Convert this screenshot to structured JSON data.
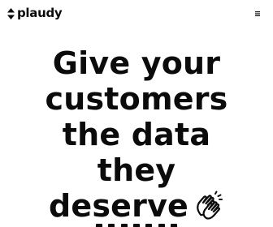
{
  "header": {
    "brand_name": "plaudy",
    "brand_icon": "up-down-arrows-icon",
    "menu_icon": "hamburger-menu-icon"
  },
  "hero": {
    "title_lines": [
      "Give your",
      "customers",
      "the data",
      "they",
      "deserve"
    ],
    "emoji_icon": "clapping-hands-icon"
  },
  "colors": {
    "text": "#0b0b0b",
    "background": "#ffffff"
  }
}
